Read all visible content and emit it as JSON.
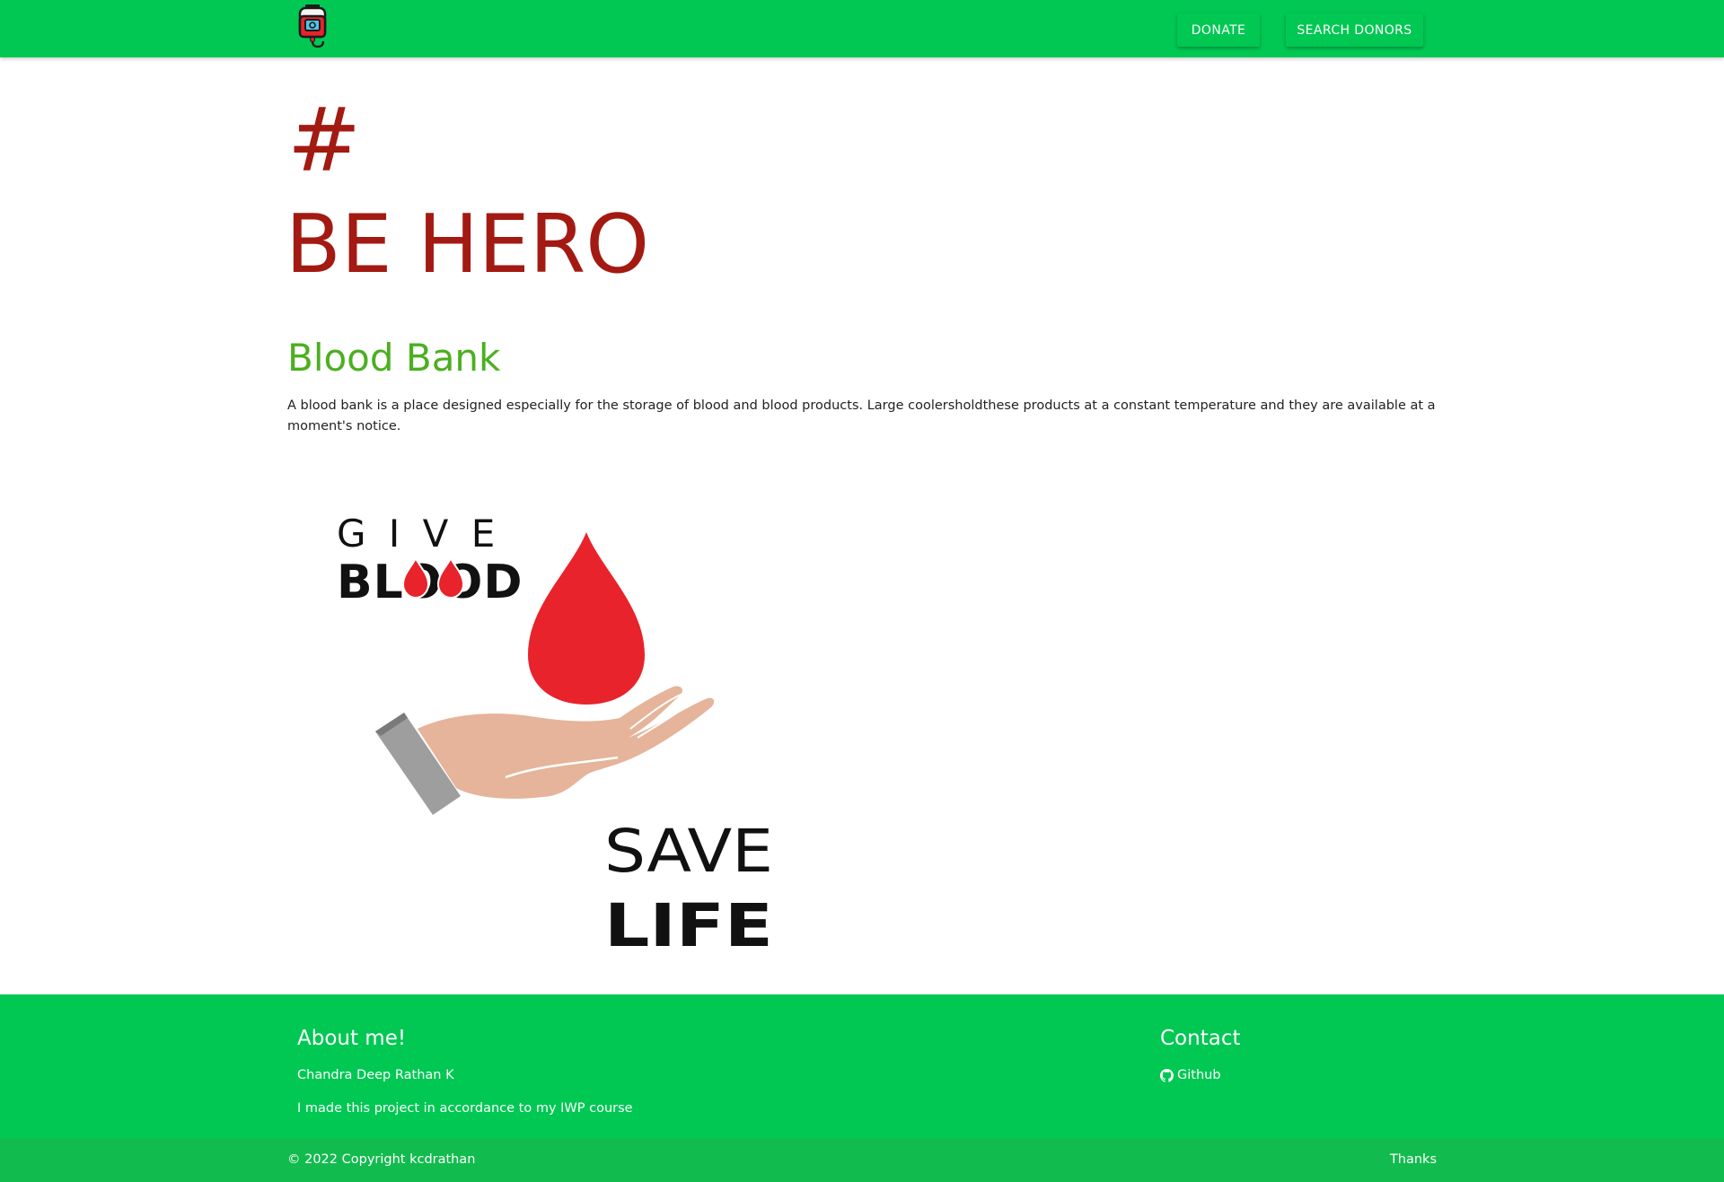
{
  "nav": {
    "logo_icon": "blood-bag-icon",
    "donate_label": "DONATE",
    "search_label": "SEARCH DONORS",
    "bg_color": "#00c853"
  },
  "hero": {
    "hashtag": "#",
    "title": "BE HERO",
    "color": "#a31a12"
  },
  "section": {
    "title": "Blood Bank",
    "text": "A blood bank is a place designed especially for the storage of blood and blood products. Large coolersholdthese products at a constant temperature and they are available at a moment's notice.",
    "title_color": "#4caf20"
  },
  "illustration": {
    "top_word": "G I V E",
    "top_word_bold": "BLOOD",
    "bottom_word": "SAVE",
    "bottom_word_bold": "LIFE",
    "drop_color": "#e8232b",
    "hand_color": "#e5b49a"
  },
  "footer": {
    "about_title": "About me!",
    "about_name": "Chandra Deep Rathan K",
    "about_desc": "I made this project in accordance to my IWP course",
    "contact_title": "Contact",
    "github_icon": "github-icon",
    "github_label": "Github",
    "copyright": "© 2022 Copyright kcdrathan",
    "thanks": "Thanks"
  }
}
